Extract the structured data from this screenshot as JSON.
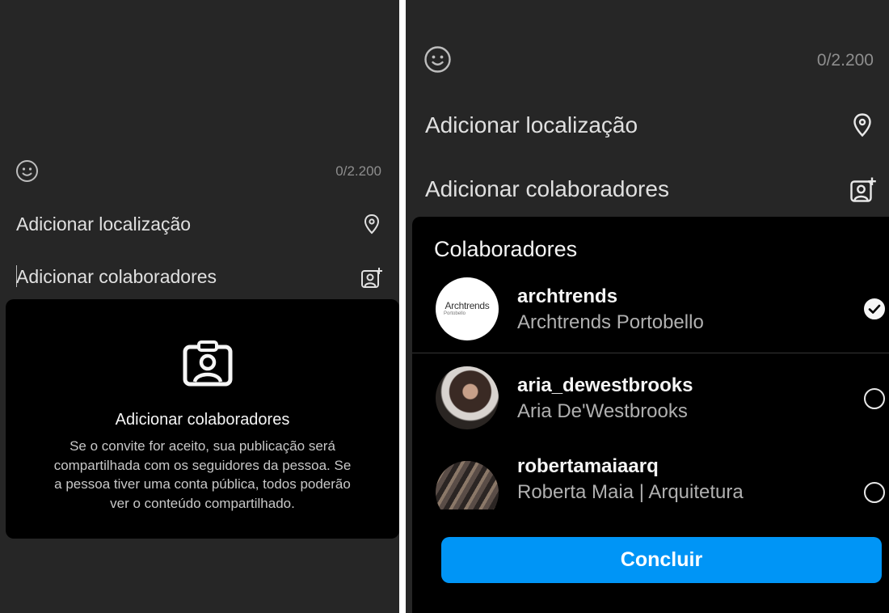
{
  "left": {
    "char_count": "0/2.200",
    "add_location_label": "Adicionar localização",
    "add_collaborators_label": "Adicionar colaboradores",
    "info_title": "Adicionar colaboradores",
    "info_body_lines": [
      "Se o convite for aceito, sua publicação será",
      "compartilhada com os seguidores da pessoa. Se",
      "a pessoa tiver uma conta pública, todos poderão",
      "ver o conteúdo compartilhado."
    ]
  },
  "right": {
    "char_count": "0/2.200",
    "add_location_label": "Adicionar localização",
    "add_collaborators_label": "Adicionar colaboradores",
    "sheet_title": "Colaboradores",
    "collaborators": [
      {
        "username": "archtrends",
        "full_name": "Archtrends Portobello",
        "selected": true,
        "avatar_logo_text": "Archtrends",
        "avatar_logo_sub": "Portobello"
      },
      {
        "username": "aria_dewestbrooks",
        "full_name": "Aria De'Westbrooks",
        "selected": false
      },
      {
        "username": "robertamaiaarq",
        "full_name": "Roberta Maia | Arquitetura",
        "selected": false
      }
    ],
    "done_label": "Concluir"
  },
  "icons": [
    "smiley-icon",
    "location-pin-icon",
    "add-person-icon",
    "collaborator-badge-icon",
    "checkmark-icon"
  ],
  "colors": {
    "background": "#262626",
    "sheet": "#000000",
    "accent": "#0095f6",
    "text": "#e0e0e0",
    "muted": "#8e8e8e"
  }
}
